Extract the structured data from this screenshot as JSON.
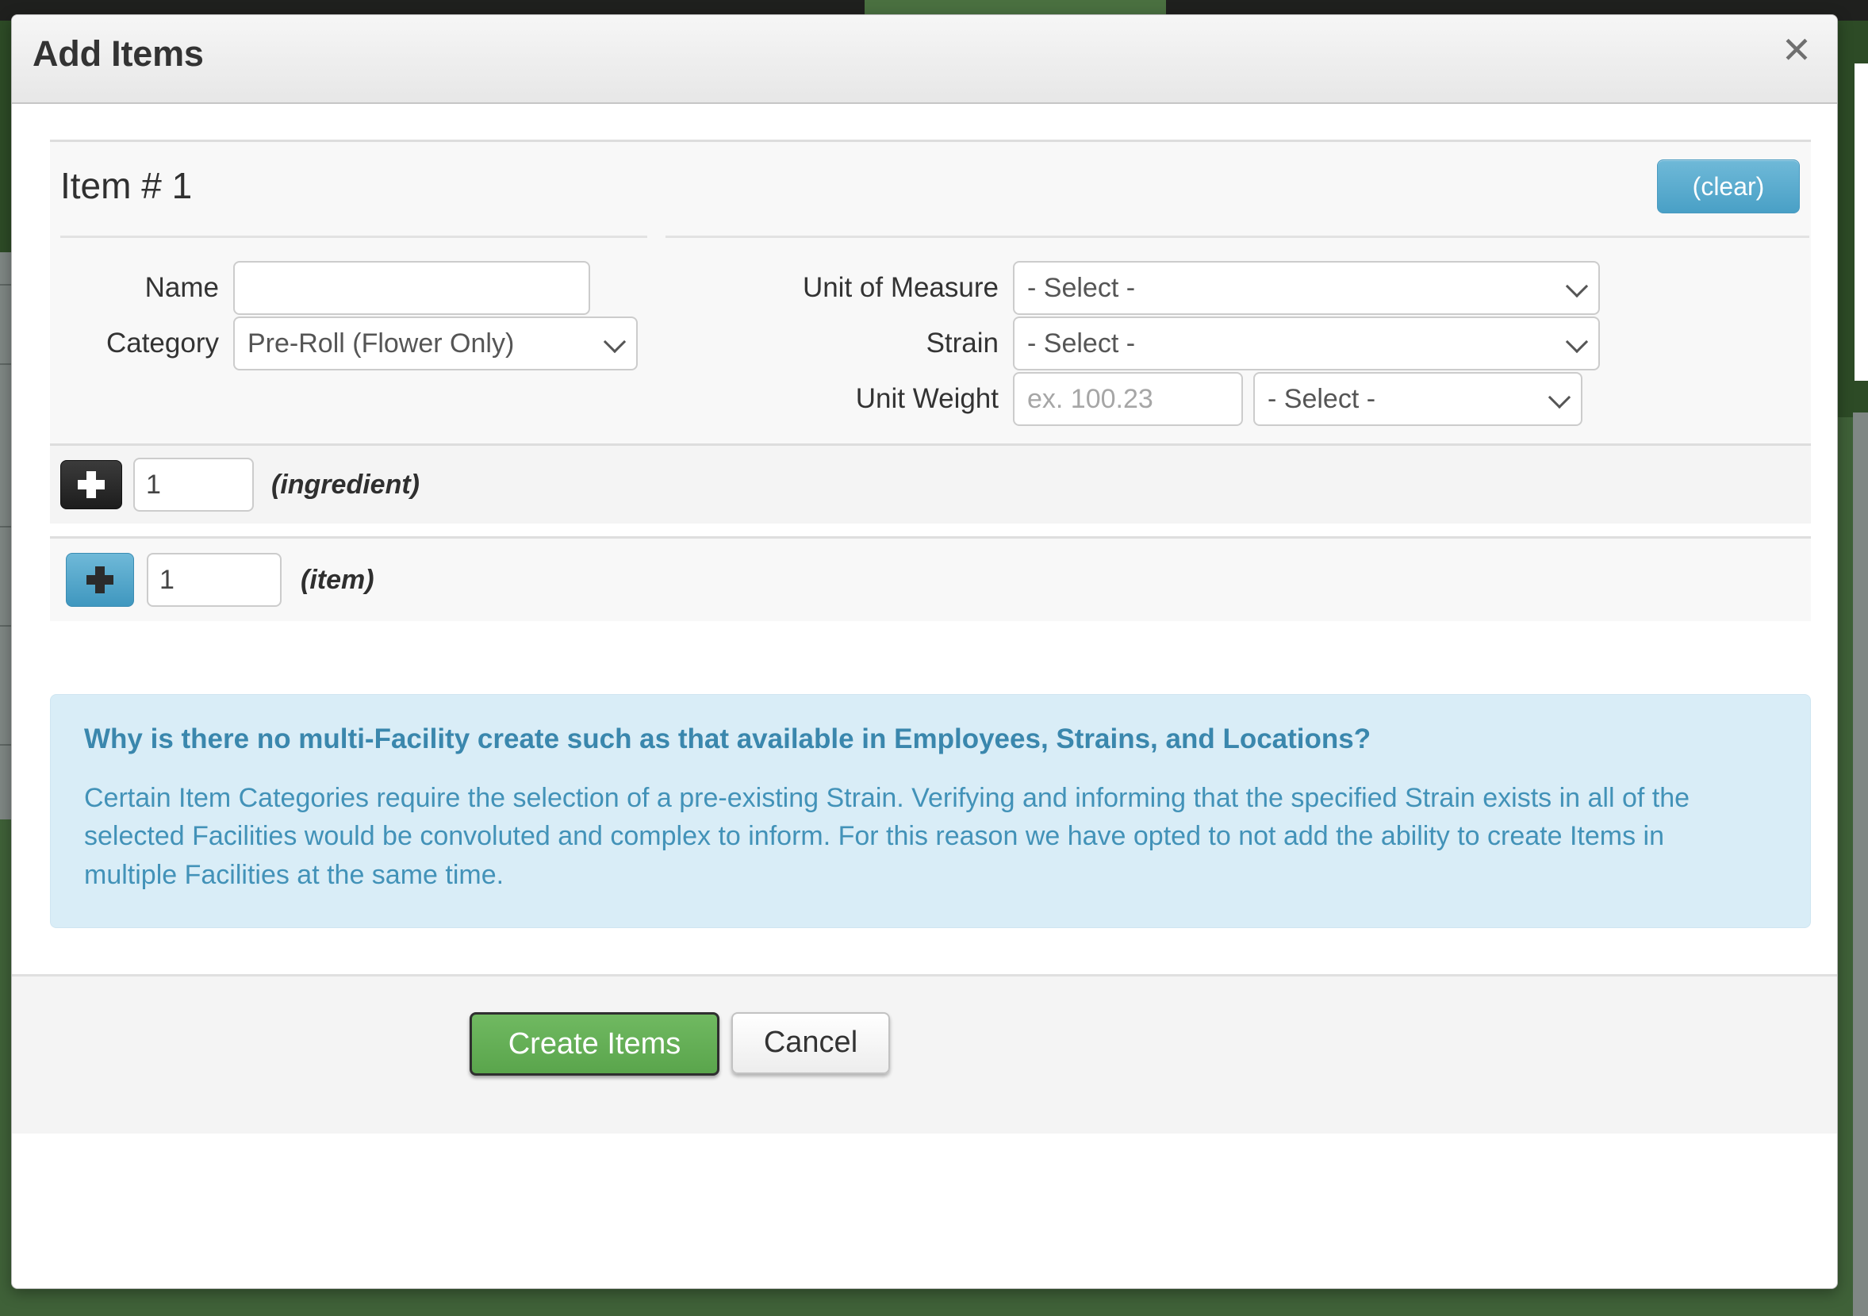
{
  "modal": {
    "title": "Add Items",
    "close_icon": "close-icon",
    "close_glyph": "✕"
  },
  "item_card": {
    "heading": "Item # 1",
    "clear_label": "(clear)",
    "fields": {
      "left": [
        {
          "label": "Name",
          "type": "text",
          "value": "",
          "placeholder": ""
        },
        {
          "label": "Category",
          "type": "select",
          "value": "Pre-Roll (Flower Only)"
        }
      ],
      "right": [
        {
          "label": "Unit of Measure",
          "type": "select",
          "value": "- Select -"
        },
        {
          "label": "Strain",
          "type": "select",
          "value": "- Select -"
        },
        {
          "label": "Unit Weight",
          "type": "text",
          "value": "",
          "placeholder": "ex. 100.23",
          "unit_select_value": "- Select -"
        }
      ]
    }
  },
  "add_rows": [
    {
      "icon": "plus-icon",
      "qty": "1",
      "caption": "(ingredient)"
    },
    {
      "icon": "plus-icon",
      "qty": "1",
      "caption": "(item)"
    }
  ],
  "info": {
    "title": "Why is there no multi-Facility create such as that available in Employees, Strains, and Locations?",
    "body": "Certain Item Categories require the selection of a pre-existing Strain. Verifying and informing that the specified Strain exists in all of the selected Facilities would be convoluted and complex to inform. For this reason we have opted to not add the ability to create Items in multiple Facilities at the same time."
  },
  "footer": {
    "create_label": "Create Items",
    "cancel_label": "Cancel"
  },
  "colors": {
    "accent_blue": "#49a0c6",
    "info_bg": "#d9edf7",
    "info_text": "#3a87ad",
    "create_green": "#5aa54c",
    "page_bg": "#3f6138"
  }
}
